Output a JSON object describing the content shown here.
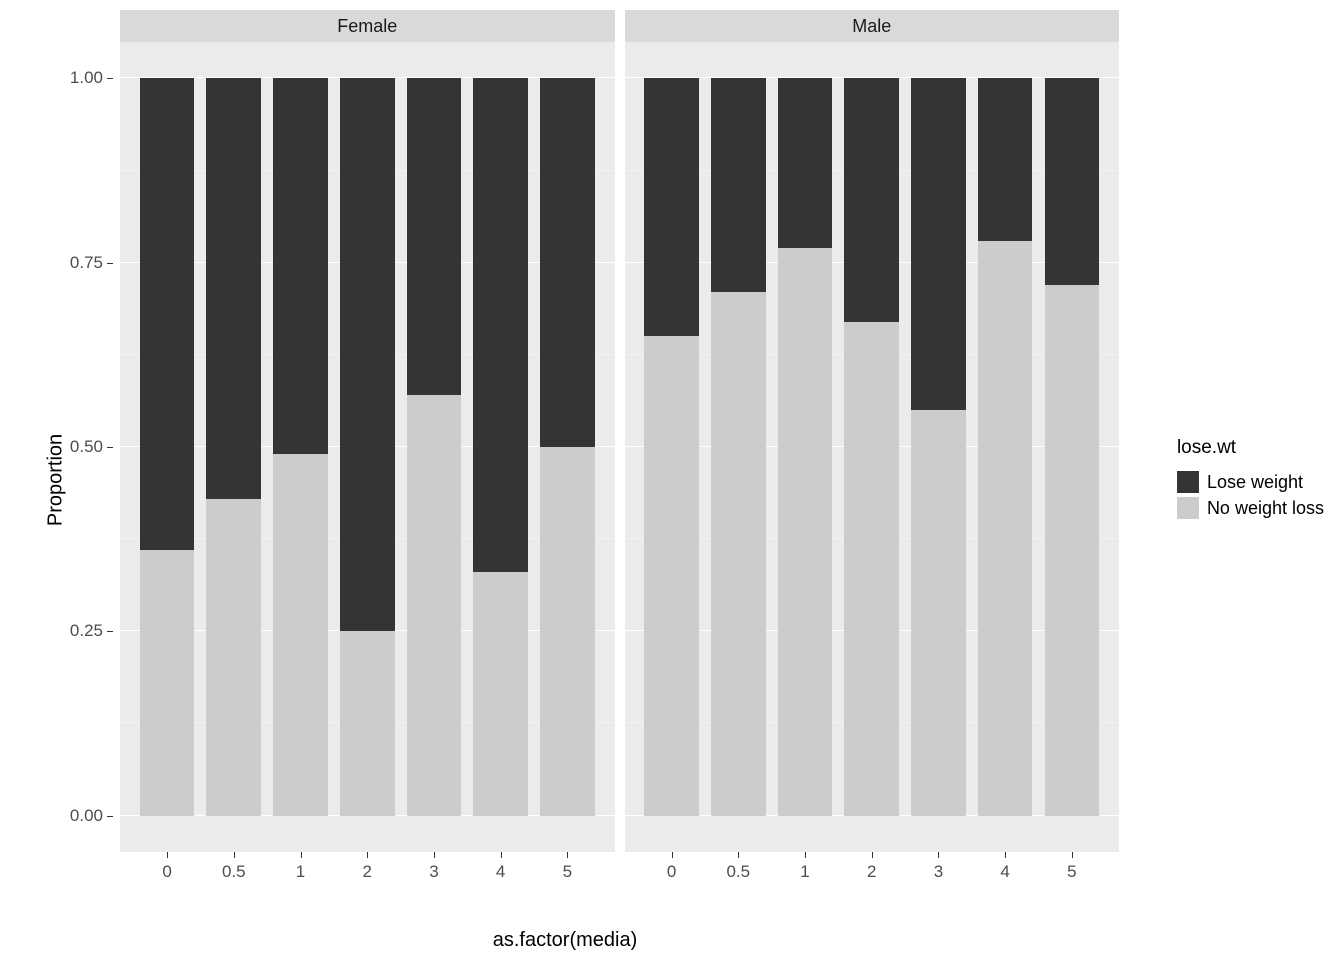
{
  "chart_data": {
    "type": "bar",
    "stacked": true,
    "facets": [
      "Female",
      "Male"
    ],
    "categories": [
      "0",
      "0.5",
      "1",
      "2",
      "3",
      "4",
      "5"
    ],
    "series_order": [
      "Lose weight",
      "No weight loss"
    ],
    "proportions": {
      "Female": {
        "No weight loss": [
          0.36,
          0.43,
          0.49,
          0.25,
          0.57,
          0.33,
          0.5
        ],
        "Lose weight": [
          0.64,
          0.57,
          0.51,
          0.75,
          0.43,
          0.67,
          0.5
        ]
      },
      "Male": {
        "No weight loss": [
          0.65,
          0.71,
          0.77,
          0.67,
          0.55,
          0.78,
          0.72
        ],
        "Lose weight": [
          0.35,
          0.29,
          0.23,
          0.33,
          0.45,
          0.22,
          0.28
        ]
      }
    },
    "ylim": [
      0,
      1
    ],
    "yticks": [
      0.0,
      0.25,
      0.5,
      0.75,
      1.0
    ],
    "ylabel": "Proportion",
    "xlabel": "as.factor(media)",
    "legend_title": "lose.wt",
    "colors": {
      "Lose weight": "#343434",
      "No weight loss": "#cccccc"
    }
  },
  "facets": {
    "0": {
      "label": "Female"
    },
    "1": {
      "label": "Male"
    }
  },
  "yticks": {
    "0": "0.00",
    "1": "0.25",
    "2": "0.50",
    "3": "0.75",
    "4": "1.00"
  },
  "xticks": {
    "0": "0",
    "1": "0.5",
    "2": "1",
    "3": "2",
    "4": "3",
    "5": "4",
    "6": "5"
  },
  "axis": {
    "ylabel": "Proportion",
    "xlabel": "as.factor(media)"
  },
  "legend": {
    "title": "lose.wt",
    "items": {
      "0": "Lose weight",
      "1": "No weight loss"
    }
  }
}
